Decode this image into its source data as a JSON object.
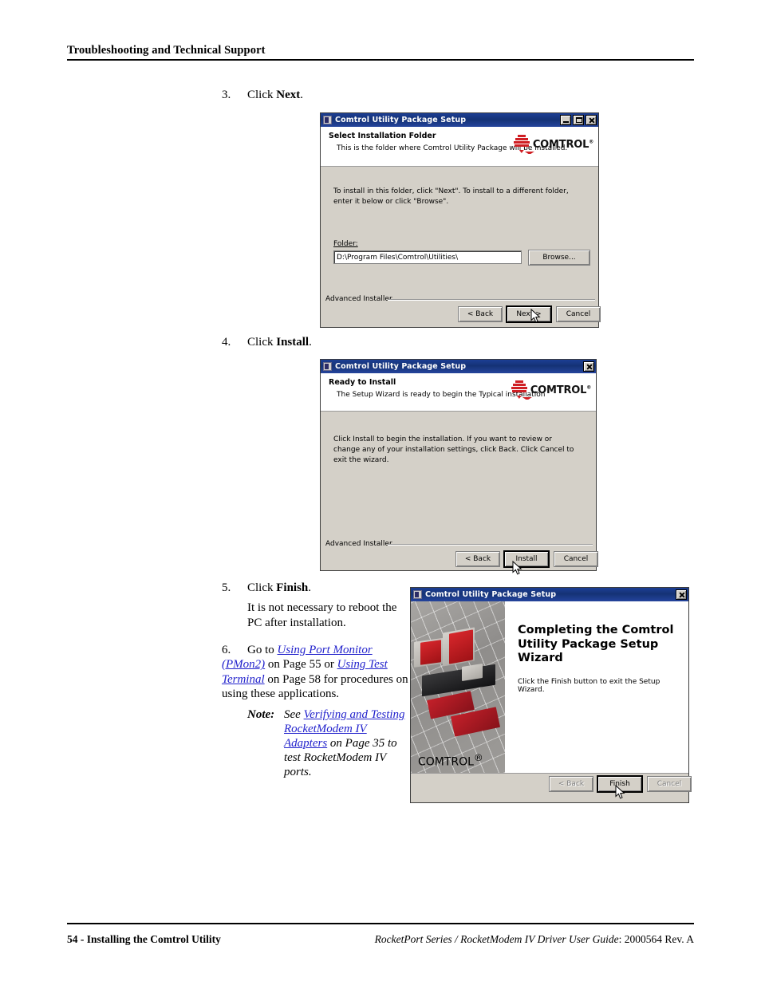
{
  "page": {
    "header": "Troubleshooting and Technical Support",
    "footer_left": "54 - Installing the Comtrol Utility",
    "footer_right_italic": "RocketPort Series / RocketModem IV Driver User Guide",
    "footer_right_rest": ": 2000564 Rev. A"
  },
  "steps": {
    "s3": {
      "num": "3.",
      "text_pre": "Click ",
      "text_bold": "Next",
      "text_post": "."
    },
    "s4": {
      "num": "4.",
      "text_pre": "Click ",
      "text_bold": "Install",
      "text_post": "."
    },
    "s5": {
      "num": "5.",
      "text_pre": "Click ",
      "text_bold": "Finish",
      "text_post": ".",
      "para": "It is not necessary to reboot the PC after installation."
    },
    "s6": {
      "num": "6.",
      "lead": "Go to ",
      "link1": "Using Port Monitor (PMon2)",
      "mid1": " on Page 55 or ",
      "link2": "Using Test Terminal",
      "mid2": " on Page 58 for procedures on using these applications."
    },
    "note": {
      "label": "Note:",
      "lead": "See ",
      "link": "Verifying and Testing RocketModem IV Adapters",
      "rest": " on Page 35 to test RocketModem IV ports."
    }
  },
  "logo": {
    "wordmark": "COMTROL",
    "registered": "®"
  },
  "dialog1": {
    "title": "Comtrol Utility Package Setup",
    "heading": "Select Installation Folder",
    "subheading": "This is the folder where Comtrol Utility Package will be installed.",
    "body": "To install in this folder, click \"Next\". To install to a different folder, enter it below or click \"Browse\".",
    "folder_label": "Folder:",
    "folder_value": "D:\\Program Files\\Comtrol\\Utilities\\",
    "browse_label": "Browse...",
    "installer_label": "Advanced Installer",
    "back_label": "< Back",
    "next_label": "Next >",
    "cancel_label": "Cancel",
    "window_buttons": [
      "minimize-button",
      "maximize-button",
      "close-button"
    ]
  },
  "dialog2": {
    "title": "Comtrol Utility Package Setup",
    "heading": "Ready to Install",
    "subheading": "The Setup Wizard is ready to begin the Typical installation",
    "body": "Click Install to begin the installation.  If you want to review or change any of your installation settings, click Back.  Click Cancel to exit the wizard.",
    "installer_label": "Advanced Installer",
    "back_label": "< Back",
    "install_label": "Install",
    "cancel_label": "Cancel",
    "window_buttons": [
      "close-button"
    ]
  },
  "dialog3": {
    "title": "Comtrol Utility Package Setup",
    "heading": "Completing the Comtrol Utility Package Setup Wizard",
    "body": "Click the Finish button to exit the Setup Wizard.",
    "back_label": "< Back",
    "finish_label": "Finish",
    "cancel_label": "Cancel",
    "window_buttons": [
      "close-button"
    ]
  },
  "colors": {
    "titlebar": "#17357e",
    "dialog_face": "#d4d0c8",
    "brand_red": "#cf1f24",
    "link": "#2222cc"
  }
}
